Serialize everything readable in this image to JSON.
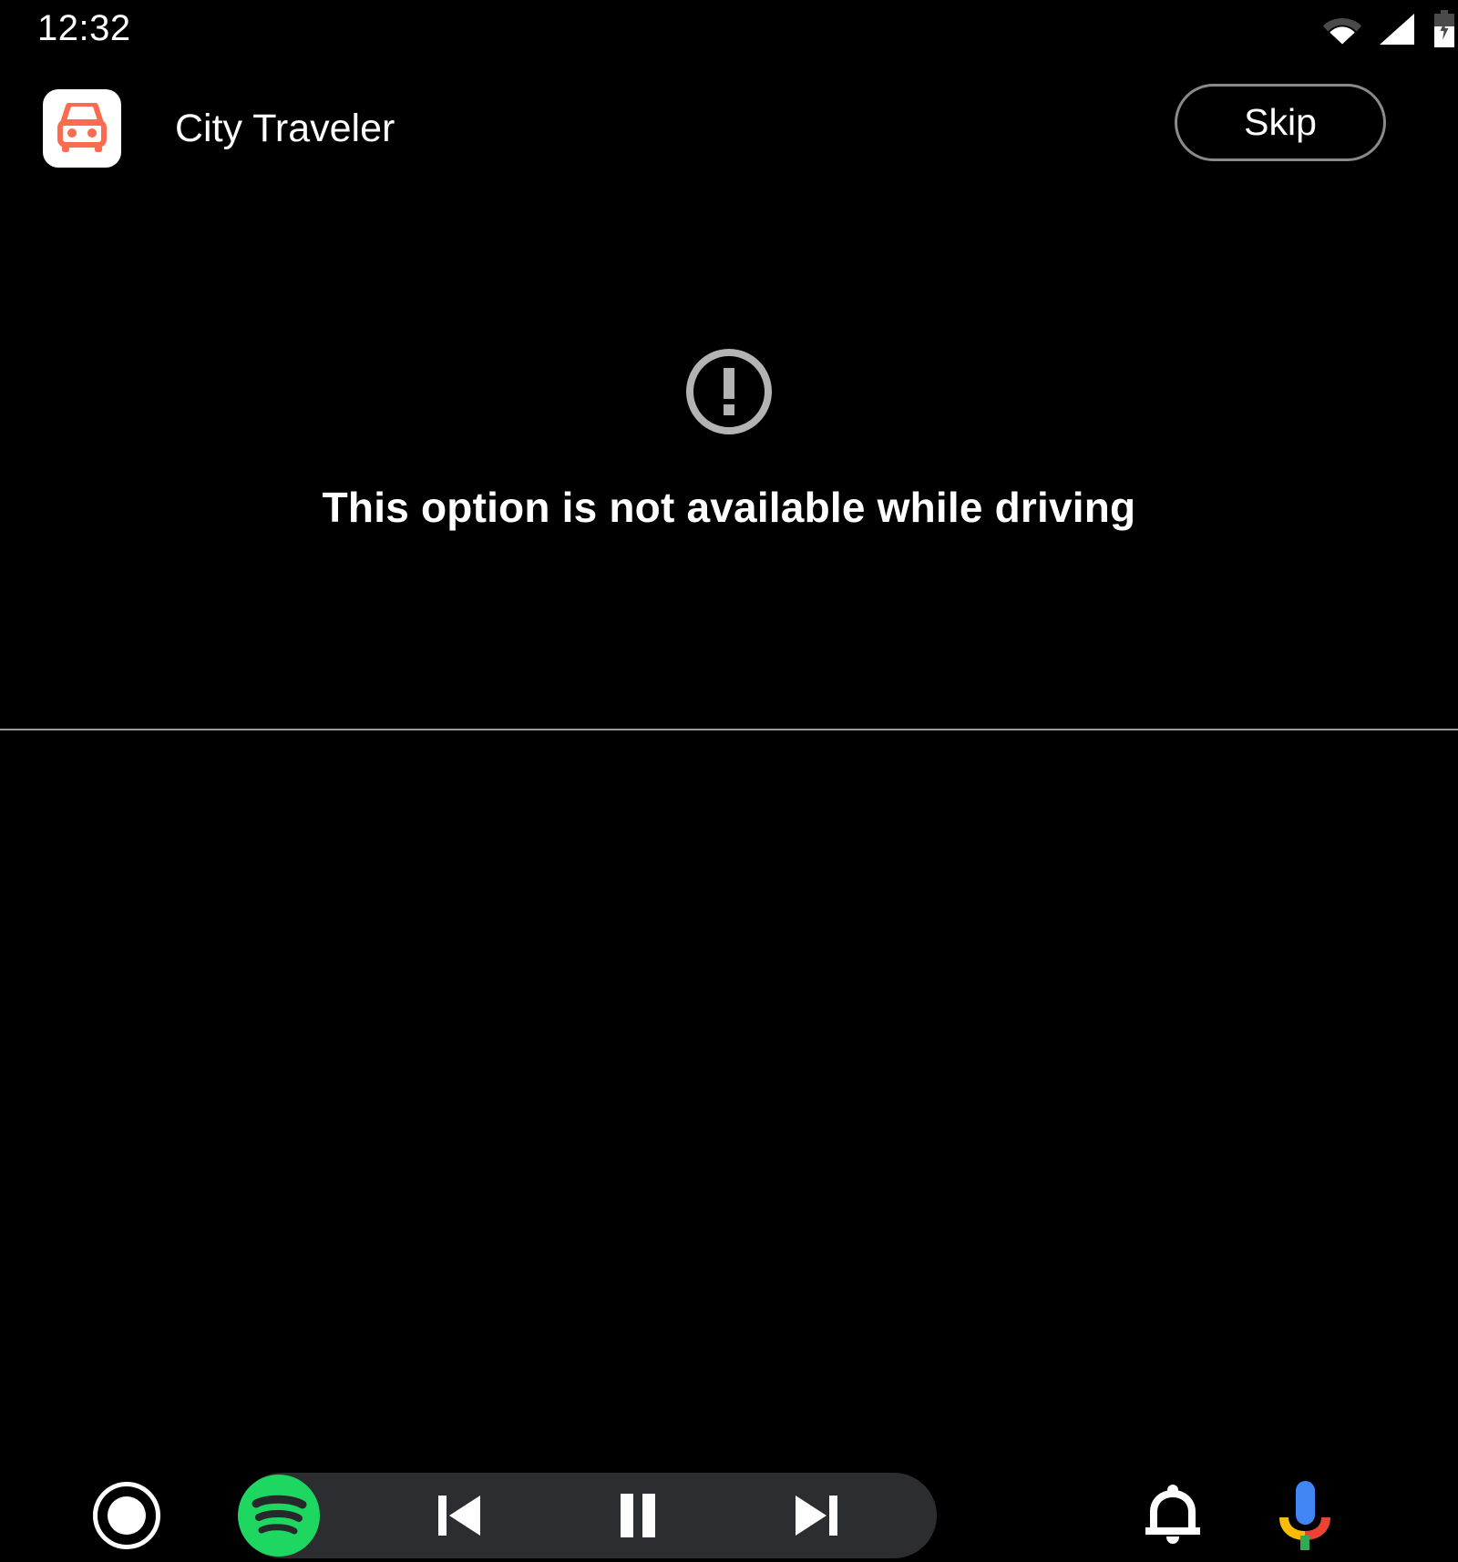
{
  "status_bar": {
    "clock": "12:32",
    "icons": [
      {
        "name": "wifi-icon",
        "label": "Wi-Fi"
      },
      {
        "name": "cellular-signal-icon",
        "label": "Cellular signal"
      },
      {
        "name": "battery-charging-icon",
        "label": "Battery charging"
      }
    ]
  },
  "header": {
    "app_icon_name": "car-app-icon",
    "app_title": "City Traveler",
    "skip_label": "Skip"
  },
  "main": {
    "warning_icon_name": "error-circle-icon",
    "message": "This option is not available while driving"
  },
  "nav_bar": {
    "home_label": "Home",
    "media_app_name": "spotify-icon",
    "previous_label": "Previous track",
    "pause_label": "Pause",
    "next_label": "Next track",
    "notifications_label": "Notifications",
    "assistant_label": "Google Assistant"
  },
  "colors": {
    "background": "#000000",
    "app_icon_accent": "#fb6b50",
    "warning_gray": "#b3b3b3",
    "divider_gray": "#9a9a9a",
    "media_pill": "#2b2d31",
    "spotify_green": "#1ed760",
    "assistant_blue": "#4285f4",
    "assistant_red": "#ea4335",
    "assistant_yellow": "#fbbc05",
    "assistant_green": "#34a853",
    "text_primary": "#ffffff",
    "skip_border": "#8a8a8a"
  }
}
